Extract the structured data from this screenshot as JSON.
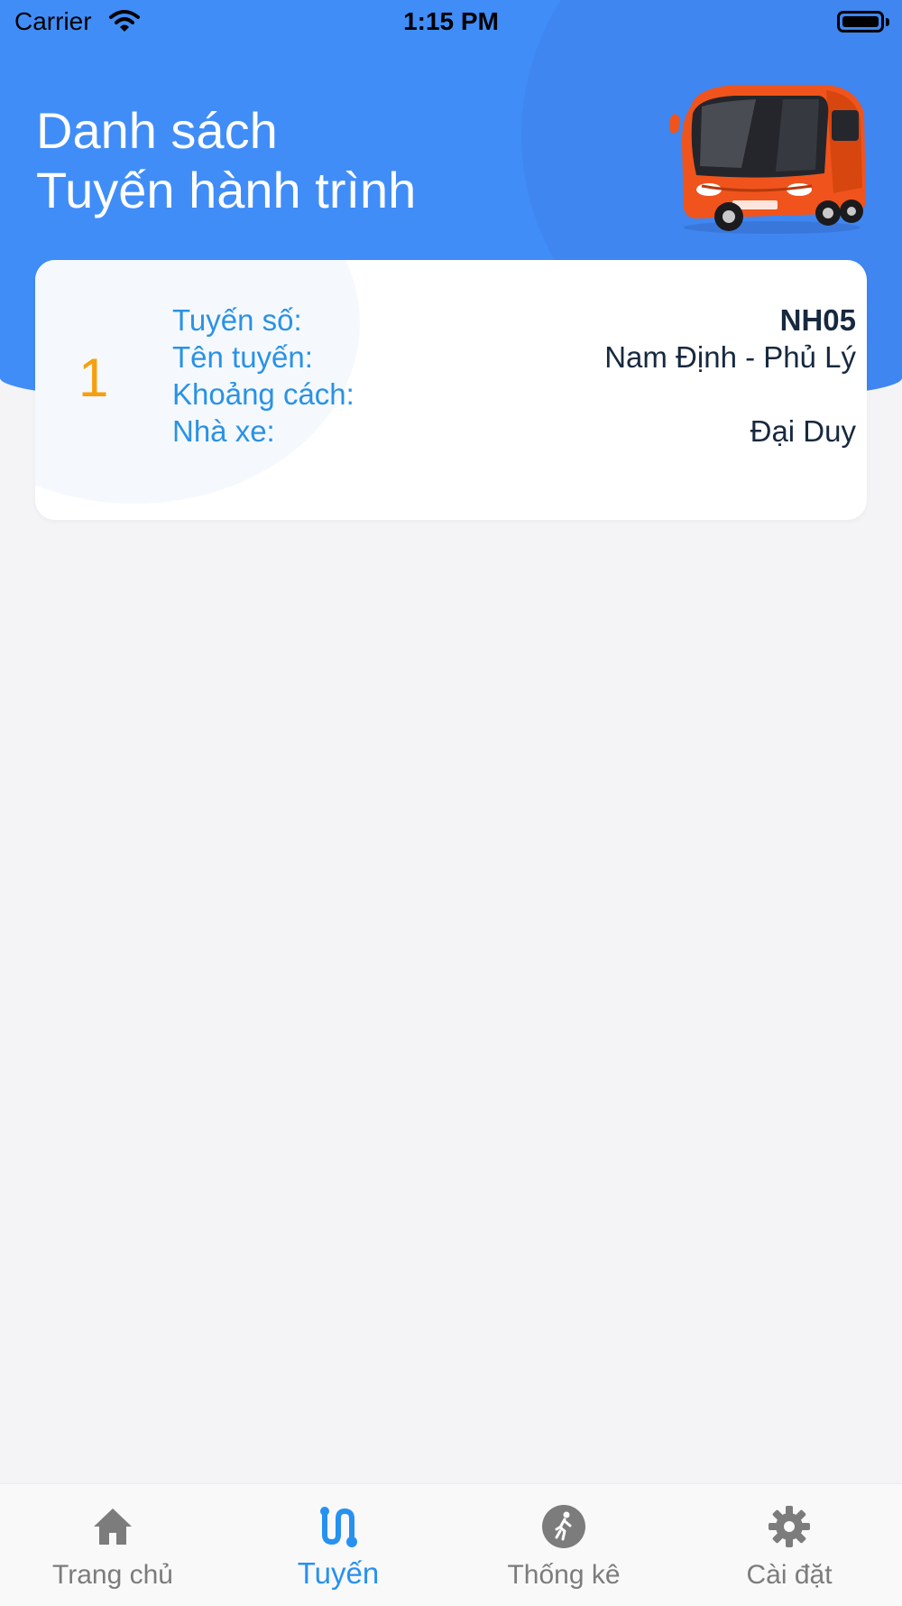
{
  "status_bar": {
    "carrier": "Carrier",
    "time": "1:15 PM"
  },
  "header": {
    "title_line1": "Danh sách",
    "title_line2": "Tuyến hành trình"
  },
  "routes": [
    {
      "index": "1",
      "fields": [
        {
          "label": "Tuyến số:",
          "value": "NH05"
        },
        {
          "label": "Tên tuyến:",
          "value": "Nam Định - Phủ Lý"
        },
        {
          "label": "Khoảng cách:",
          "value": ""
        },
        {
          "label": "Nhà xe:",
          "value": "Đại Duy"
        }
      ]
    }
  ],
  "tabbar": {
    "tabs": [
      {
        "label": "Trang chủ",
        "icon": "home-icon",
        "active": false
      },
      {
        "label": "Tuyến",
        "icon": "route-icon",
        "active": true
      },
      {
        "label": "Thống kê",
        "icon": "walking-icon",
        "active": false
      },
      {
        "label": "Cài đặt",
        "icon": "gear-icon",
        "active": false
      }
    ]
  },
  "colors": {
    "header_blue": "#408df8",
    "accent_blue": "#2791f0",
    "index_orange": "#f6a00f",
    "background": "#f4f4f7"
  }
}
